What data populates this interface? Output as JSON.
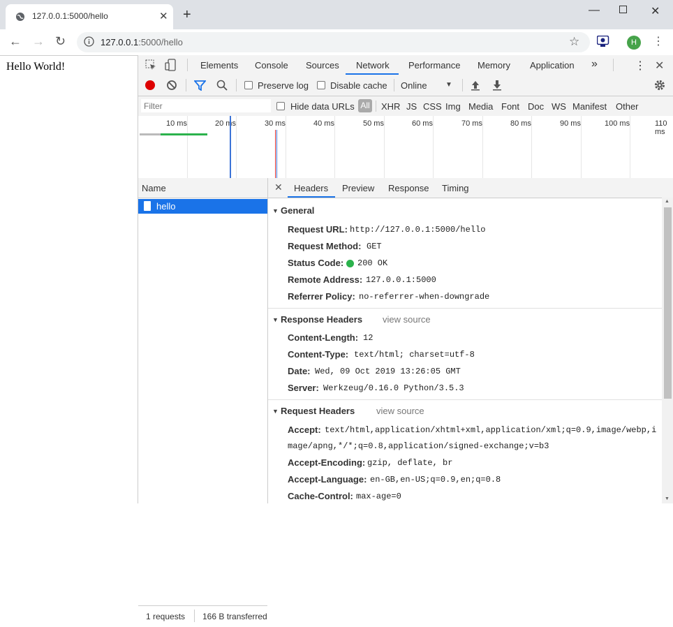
{
  "browser": {
    "tab_title": "127.0.0.1:5000/hello",
    "new_tab_icon": "plus-icon",
    "url_host": "127.0.0.1",
    "url_rest": ":5000/hello",
    "avatar_letter": "H"
  },
  "page": {
    "text": "Hello World!"
  },
  "devtools": {
    "tabs": [
      "Elements",
      "Console",
      "Sources",
      "Network",
      "Performance",
      "Memory",
      "Application"
    ],
    "active_tab": "Network",
    "more_tabs": "»",
    "toolbar": {
      "preserve_log": "Preserve log",
      "disable_cache": "Disable cache",
      "throttle": "Online"
    },
    "filterbar": {
      "filter_placeholder": "Filter",
      "hide_data_urls": "Hide data URLs",
      "all": "All",
      "types": [
        "XHR",
        "JS",
        "CSS",
        "Img",
        "Media",
        "Font",
        "Doc",
        "WS",
        "Manifest",
        "Other"
      ]
    },
    "timeline": {
      "ticks": [
        "10 ms",
        "20 ms",
        "30 ms",
        "40 ms",
        "50 ms",
        "60 ms",
        "70 ms",
        "80 ms",
        "90 ms",
        "100 ms",
        "110 ms"
      ]
    },
    "requests": {
      "name_header": "Name",
      "items": [
        "hello"
      ],
      "status_requests": "1 requests",
      "status_transferred": "166 B transferred"
    },
    "details": {
      "tabs": [
        "Headers",
        "Preview",
        "Response",
        "Timing"
      ],
      "active_tab": "Headers",
      "general": {
        "title": "General",
        "request_url_key": "Request URL:",
        "request_url": "http://127.0.0.1:5000/hello",
        "request_method_key": "Request Method:",
        "request_method": "GET",
        "status_code_key": "Status Code:",
        "status_code": "200 OK",
        "status_color": "#2bb24c",
        "remote_address_key": "Remote Address:",
        "remote_address": "127.0.0.1:5000",
        "referrer_policy_key": "Referrer Policy:",
        "referrer_policy": "no-referrer-when-downgrade"
      },
      "response_headers": {
        "title": "Response Headers",
        "view_source": "view source",
        "content_length_key": "Content-Length:",
        "content_length": "12",
        "content_type_key": "Content-Type:",
        "content_type": "text/html; charset=utf-8",
        "date_key": "Date:",
        "date": "Wed, 09 Oct 2019 13:26:05 GMT",
        "server_key": "Server:",
        "server": "Werkzeug/0.16.0 Python/3.5.3"
      },
      "request_headers": {
        "title": "Request Headers",
        "view_source": "view source",
        "accept_key": "Accept:",
        "accept_line1": "text/html,application/xhtml+xml,application/xml;q=0.9,image/webp,i",
        "accept_line2": "mage/apng,*/*;q=0.8,application/signed-exchange;v=b3",
        "accept_encoding_key": "Accept-Encoding:",
        "accept_encoding": "gzip, deflate, br",
        "accept_language_key": "Accept-Language:",
        "accept_language": "en-GB,en-US;q=0.9,en;q=0.8",
        "cache_control_key": "Cache-Control:",
        "cache_control": "max-age=0"
      }
    }
  }
}
